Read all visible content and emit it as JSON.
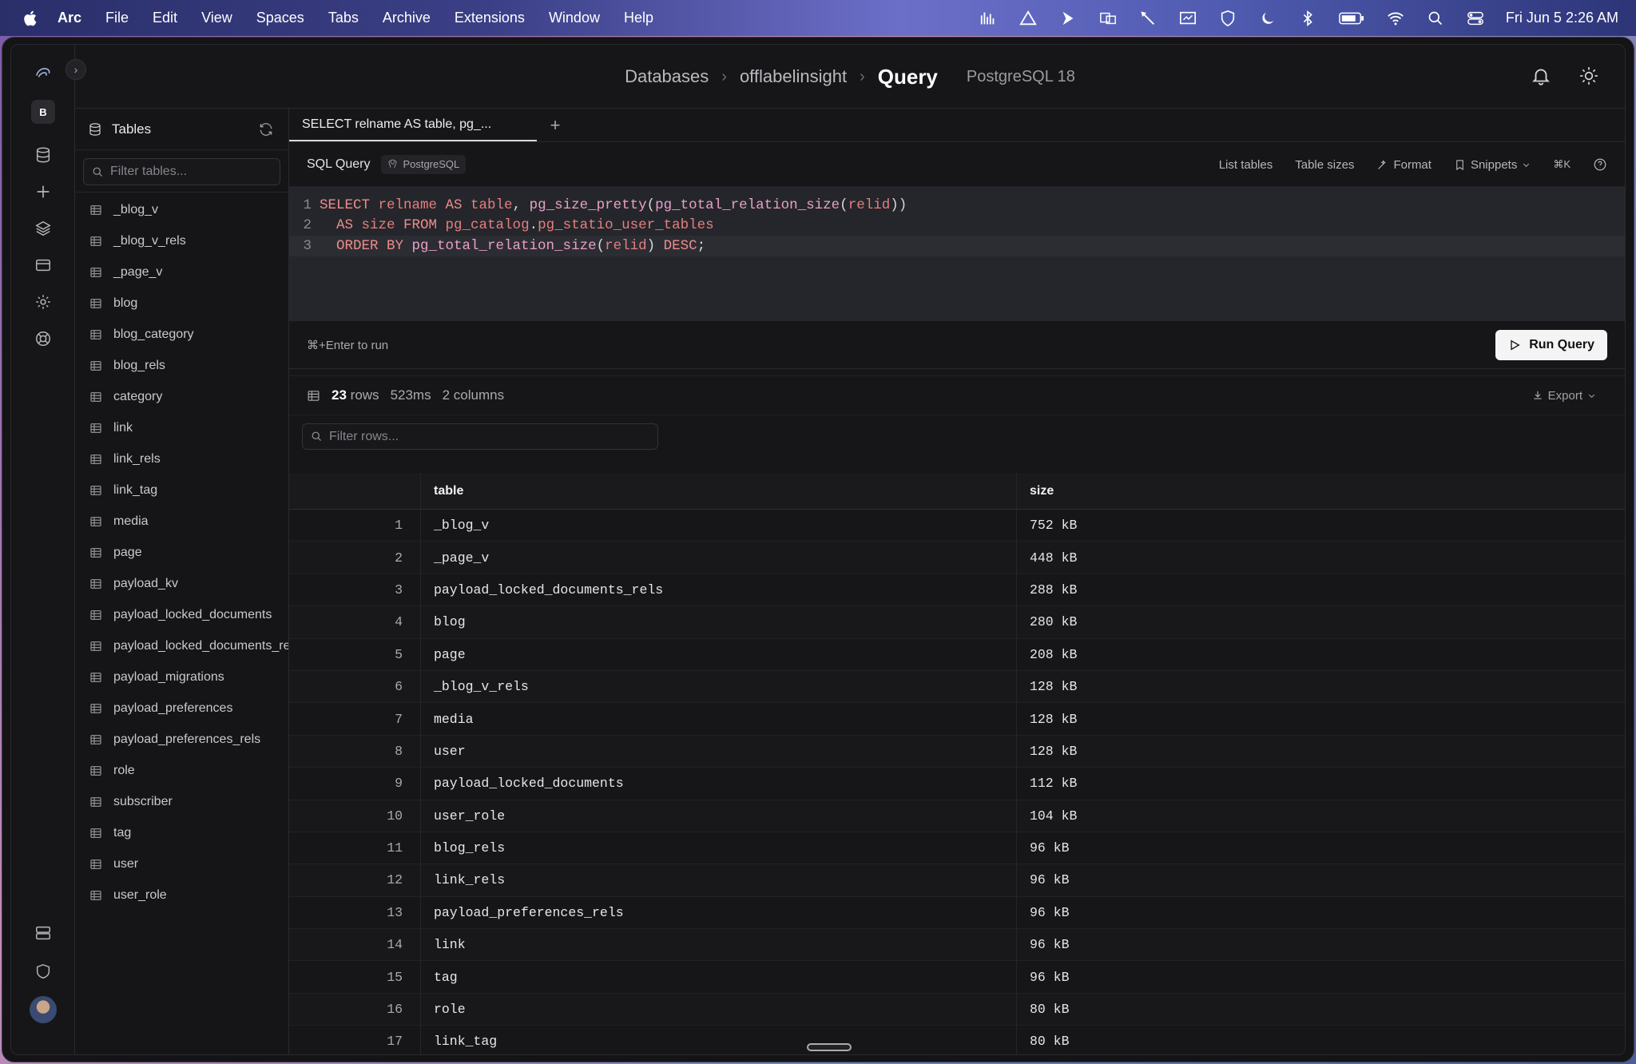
{
  "menubar": {
    "app": "Arc",
    "items": [
      "File",
      "Edit",
      "View",
      "Spaces",
      "Tabs",
      "Archive",
      "Extensions",
      "Window",
      "Help"
    ],
    "clock": "Fri Jun 5  2:26 AM"
  },
  "rail": {
    "workspace_badge": "B"
  },
  "header": {
    "breadcrumb": [
      "Databases",
      "offlabelinsight"
    ],
    "current": "Query",
    "engine": "PostgreSQL 18"
  },
  "sidebar": {
    "title": "Tables",
    "filter_placeholder": "Filter tables...",
    "tables": [
      "_blog_v",
      "_blog_v_rels",
      "_page_v",
      "blog",
      "blog_category",
      "blog_rels",
      "category",
      "link",
      "link_rels",
      "link_tag",
      "media",
      "page",
      "payload_kv",
      "payload_locked_documents",
      "payload_locked_documents_rels",
      "payload_migrations",
      "payload_preferences",
      "payload_preferences_rels",
      "role",
      "subscriber",
      "tag",
      "user",
      "user_role"
    ]
  },
  "tabs": {
    "active": "SELECT relname AS table, pg_...",
    "add_label": "+"
  },
  "query_toolbar": {
    "title": "SQL Query",
    "dialect": "PostgreSQL",
    "list_tables": "List tables",
    "table_sizes": "Table sizes",
    "format": "Format",
    "snippets": "Snippets",
    "shortcut": "⌘K"
  },
  "editor": {
    "line_numbers": [
      "1",
      "2",
      "3"
    ]
  },
  "run": {
    "hint": "⌘+Enter to run",
    "button": "Run Query"
  },
  "result_summary": {
    "rows": "23",
    "rows_label": "rows",
    "time": "523ms",
    "columns": "2 columns",
    "export": "Export"
  },
  "row_filter_placeholder": "Filter rows...",
  "results": {
    "columns": [
      "table",
      "size"
    ],
    "rows": [
      [
        "1",
        "_blog_v",
        "752 kB"
      ],
      [
        "2",
        "_page_v",
        "448 kB"
      ],
      [
        "3",
        "payload_locked_documents_rels",
        "288 kB"
      ],
      [
        "4",
        "blog",
        "280 kB"
      ],
      [
        "5",
        "page",
        "208 kB"
      ],
      [
        "6",
        "_blog_v_rels",
        "128 kB"
      ],
      [
        "7",
        "media",
        "128 kB"
      ],
      [
        "8",
        "user",
        "128 kB"
      ],
      [
        "9",
        "payload_locked_documents",
        "112 kB"
      ],
      [
        "10",
        "user_role",
        "104 kB"
      ],
      [
        "11",
        "blog_rels",
        "96 kB"
      ],
      [
        "12",
        "link_rels",
        "96 kB"
      ],
      [
        "13",
        "payload_preferences_rels",
        "96 kB"
      ],
      [
        "14",
        "link",
        "96 kB"
      ],
      [
        "15",
        "tag",
        "96 kB"
      ],
      [
        "16",
        "role",
        "80 kB"
      ],
      [
        "17",
        "link_tag",
        "80 kB"
      ]
    ]
  }
}
